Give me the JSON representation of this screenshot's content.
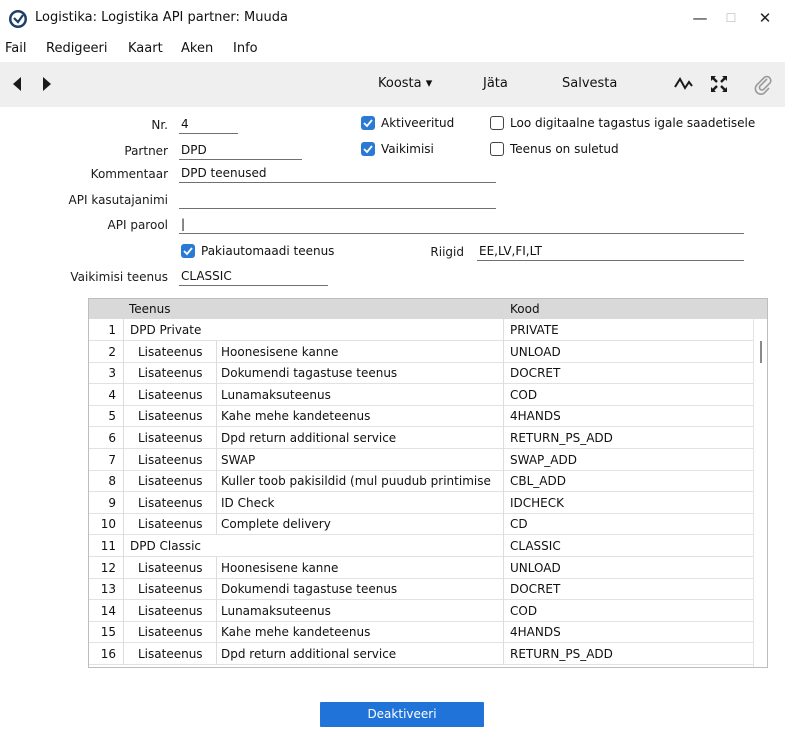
{
  "window": {
    "title": "Logistika: Logistika API partner: Muuda",
    "minimize": "—",
    "maximize": "☐",
    "close": "✕"
  },
  "menu": [
    "Fail",
    "Redigeeri",
    "Kaart",
    "Aken",
    "Info"
  ],
  "toolbar": {
    "koosta": "Koosta ▾",
    "jata": "Jäta",
    "salvesta": "Salvesta"
  },
  "form": {
    "nr_label": "Nr.",
    "nr_value": "4",
    "partner_label": "Partner",
    "partner_value": "DPD",
    "kommentaar_label": "Kommentaar",
    "kommentaar_value": "DPD teenused",
    "api_user_label": "API kasutajanimi",
    "api_user_value": "",
    "api_pass_label": "API parool",
    "api_pass_value": "|",
    "aktiveeritud_label": "Aktiveeritud",
    "aktiveeritud_checked": true,
    "vaikimisi_label": "Vaikimisi",
    "vaikimisi_checked": true,
    "digital_label": "Loo digitaalne tagastus igale saadetisele",
    "digital_checked": false,
    "suletud_label": "Teenus on suletud",
    "suletud_checked": false,
    "pakiautomaadi_label": "Pakiautomaadi teenus",
    "pakiautomaadi_checked": true,
    "riigid_label": "Riigid",
    "riigid_value": "EE,LV,FI,LT",
    "vaikimisi_teenus_label": "Vaikimisi teenus",
    "vaikimisi_teenus_value": "CLASSIC"
  },
  "table": {
    "columns": [
      "Teenus",
      "Kood"
    ],
    "rows": [
      {
        "n": "1",
        "a": "DPD Private",
        "b": "",
        "kood": "PRIVATE"
      },
      {
        "n": "2",
        "a": "Lisateenus",
        "b": "Hoonesisene kanne",
        "kood": "UNLOAD"
      },
      {
        "n": "3",
        "a": "Lisateenus",
        "b": "Dokumendi tagastuse teenus",
        "kood": "DOCRET"
      },
      {
        "n": "4",
        "a": "Lisateenus",
        "b": "Lunamaksuteenus",
        "kood": "COD"
      },
      {
        "n": "5",
        "a": "Lisateenus",
        "b": "Kahe mehe kandeteenus",
        "kood": "4HANDS"
      },
      {
        "n": "6",
        "a": "Lisateenus",
        "b": "Dpd return additional service",
        "kood": "RETURN_PS_ADD"
      },
      {
        "n": "7",
        "a": "Lisateenus",
        "b": "SWAP",
        "kood": "SWAP_ADD"
      },
      {
        "n": "8",
        "a": "Lisateenus",
        "b": "Kuller toob pakisildid (mul puudub printimise",
        "kood": "CBL_ADD"
      },
      {
        "n": "9",
        "a": "Lisateenus",
        "b": "ID Check",
        "kood": "IDCHECK"
      },
      {
        "n": "10",
        "a": "Lisateenus",
        "b": "Complete delivery",
        "kood": "CD"
      },
      {
        "n": "11",
        "a": "DPD Classic",
        "b": "",
        "kood": "CLASSIC"
      },
      {
        "n": "12",
        "a": "Lisateenus",
        "b": "Hoonesisene kanne",
        "kood": "UNLOAD"
      },
      {
        "n": "13",
        "a": "Lisateenus",
        "b": "Dokumendi tagastuse teenus",
        "kood": "DOCRET"
      },
      {
        "n": "14",
        "a": "Lisateenus",
        "b": "Lunamaksuteenus",
        "kood": "COD"
      },
      {
        "n": "15",
        "a": "Lisateenus",
        "b": "Kahe mehe kandeteenus",
        "kood": "4HANDS"
      },
      {
        "n": "16",
        "a": "Lisateenus",
        "b": "Dpd return additional service",
        "kood": "RETURN_PS_ADD"
      }
    ]
  },
  "deaktiveeri": "Deaktiveeri",
  "colors": {
    "accent": "#2073d8",
    "checkbox": "#2a7ad5",
    "toolbar_bg": "#efeff0",
    "grid_header": "#d9d9d9"
  }
}
